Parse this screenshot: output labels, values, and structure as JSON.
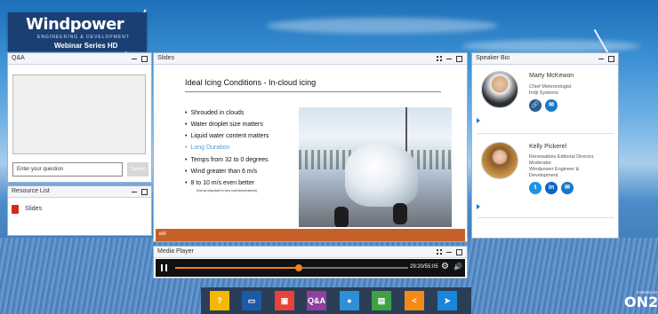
{
  "brand": {
    "name": "Windpower",
    "sub": "ENGINEERING & DEVELOPMENT",
    "series": "Webinar Series HD"
  },
  "qa": {
    "title": "Q&A",
    "input_placeholder": "Enter your question",
    "submit_label": "Submit"
  },
  "resources": {
    "title": "Resource List",
    "items": [
      {
        "label": "Slides",
        "icon": "pdf-icon"
      }
    ]
  },
  "slides": {
    "title": "Slides",
    "slide_title": "Ideal Icing Conditions  - In-cloud icing",
    "bullets": [
      "Shrouded in clouds",
      "Water droplet size matters",
      "Liquid water content matters",
      "Long Duration",
      "Temps from 32 to 0 degrees",
      "Wind greater than 6 m/s",
      "8 to 10 m/s even better"
    ],
    "note": "(Not as important in very cold temperatures)",
    "highlight_color": "#4a9ee0",
    "footer_logo": "eki"
  },
  "media": {
    "title": "Media Player",
    "time": "29:20/55:05",
    "progress": 0.53,
    "accent": "#f47f20"
  },
  "speakers": {
    "title": "Speaker Bio",
    "list": [
      {
        "name": "Marty McKewon",
        "info": [
          "Chief Meteorologist",
          "Indji Systems"
        ]
      },
      {
        "name": "Kelly Pickerel",
        "info": [
          "Renewables Editorial Director,",
          "Moderator",
          "Windpower Engineer &",
          "Development"
        ]
      }
    ]
  },
  "dock": {
    "buttons": [
      {
        "name": "help-button",
        "icon": "question-icon",
        "label": "?",
        "color": "#f5b800"
      },
      {
        "name": "slides-button",
        "icon": "presentation-icon",
        "label": "",
        "color": "#1c5aa6"
      },
      {
        "name": "video-button",
        "icon": "film-icon",
        "label": "",
        "color": "#e8433a"
      },
      {
        "name": "qa-button",
        "icon": "qa-icon",
        "label": "Q&A",
        "color": "#8e3fa0"
      },
      {
        "name": "speaker-button",
        "icon": "person-icon",
        "label": "",
        "color": "#2d8fd6"
      },
      {
        "name": "resources-button",
        "icon": "document-icon",
        "label": "",
        "color": "#3ea143"
      },
      {
        "name": "share-button",
        "icon": "share-icon",
        "label": "",
        "color": "#f28a19"
      },
      {
        "name": "email-button",
        "icon": "send-icon",
        "label": "",
        "color": "#1a86d9"
      }
    ]
  },
  "footer": {
    "powered": "POWERED BY",
    "on24": "ON24"
  }
}
